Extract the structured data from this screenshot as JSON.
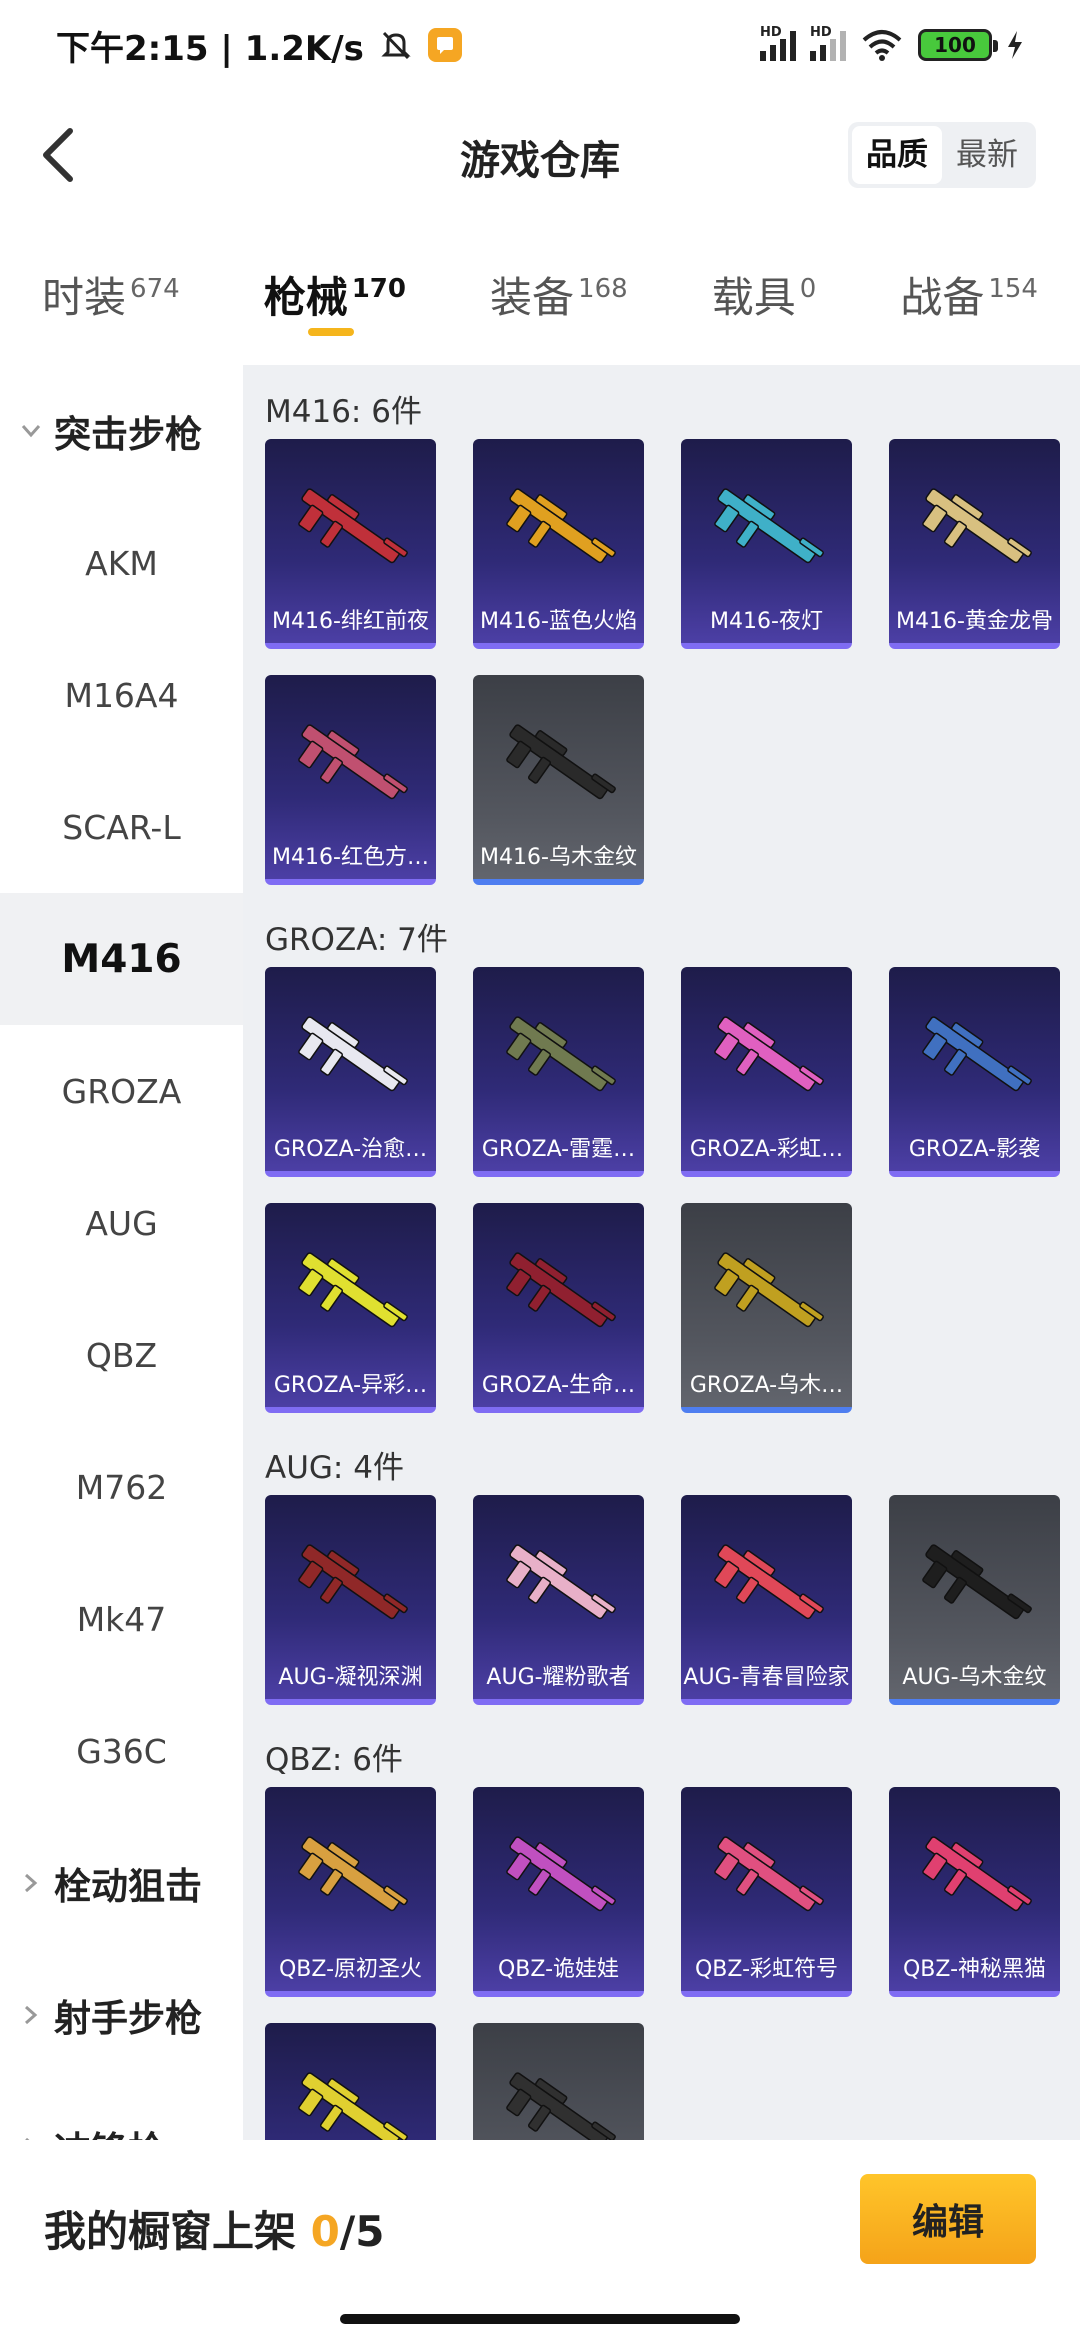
{
  "status_bar": {
    "time": "下午2:15 | 1.2K/s",
    "hd1": "HD",
    "hd2": "HD",
    "battery": "100"
  },
  "header": {
    "title": "游戏仓库",
    "sort_options": [
      "品质",
      "最新"
    ]
  },
  "tabs": [
    {
      "label": "时装",
      "count": "674"
    },
    {
      "label": "枪械",
      "count": "170"
    },
    {
      "label": "装备",
      "count": "168"
    },
    {
      "label": "载具",
      "count": "0"
    },
    {
      "label": "战备",
      "count": "154"
    }
  ],
  "sidebar": {
    "group_open": "突击步枪",
    "items": [
      "AKM",
      "M16A4",
      "SCAR-L",
      "M416",
      "GROZA",
      "AUG",
      "QBZ",
      "M762",
      "Mk47",
      "G36C"
    ],
    "group_closed_1": "栓动狙击",
    "group_closed_2": "射手步枪",
    "group_closed_3": "冲锋枪"
  },
  "sections": [
    {
      "title": "M416: 6件",
      "items": [
        {
          "label": "M416-绯红前夜",
          "gray": false,
          "color": "#c0303a"
        },
        {
          "label": "M416-蓝色火焰",
          "gray": false,
          "color": "#e0a020"
        },
        {
          "label": "M416-夜灯",
          "gray": false,
          "color": "#3fb0c8"
        },
        {
          "label": "M416-黄金龙骨",
          "gray": false,
          "color": "#d8c080"
        },
        {
          "label": "M416-红色方…",
          "gray": false,
          "color": "#c05070"
        },
        {
          "label": "M416-乌木金纹",
          "gray": true,
          "color": "#2a2a2a"
        }
      ]
    },
    {
      "title": "GROZA: 7件",
      "items": [
        {
          "label": "GROZA-治愈…",
          "gray": false,
          "color": "#e8e8f0"
        },
        {
          "label": "GROZA-雷霆…",
          "gray": false,
          "color": "#707a50"
        },
        {
          "label": "GROZA-彩虹…",
          "gray": false,
          "color": "#e060c0"
        },
        {
          "label": "GROZA-影袭",
          "gray": false,
          "color": "#4070c0"
        },
        {
          "label": "GROZA-异彩…",
          "gray": false,
          "color": "#e0e030"
        },
        {
          "label": "GROZA-生命…",
          "gray": false,
          "color": "#902030"
        },
        {
          "label": "GROZA-乌木…",
          "gray": true,
          "color": "#c0a020"
        }
      ]
    },
    {
      "title": "AUG: 4件",
      "items": [
        {
          "label": "AUG-凝视深渊",
          "gray": false,
          "color": "#902828"
        },
        {
          "label": "AUG-耀粉歌者",
          "gray": false,
          "color": "#e8b0c8"
        },
        {
          "label": "AUG-青春冒险家",
          "gray": false,
          "color": "#e04858"
        },
        {
          "label": "AUG-乌木金纹",
          "gray": true,
          "color": "#1e1e1e"
        }
      ]
    },
    {
      "title": "QBZ: 6件",
      "items": [
        {
          "label": "QBZ-原初圣火",
          "gray": false,
          "color": "#d8a040"
        },
        {
          "label": "QBZ-诡娃娃",
          "gray": false,
          "color": "#c050c0"
        },
        {
          "label": "QBZ-彩虹符号",
          "gray": false,
          "color": "#e05080"
        },
        {
          "label": "QBZ-神秘黑猫",
          "gray": false,
          "color": "#e04070"
        },
        {
          "label": "",
          "gray": false,
          "color": "#e0d030"
        },
        {
          "label": "",
          "gray": true,
          "color": "#303030"
        }
      ]
    }
  ],
  "bottom": {
    "shelf_label": "我的橱窗上架",
    "shelf_current": "0",
    "shelf_total": "/5",
    "edit_label": "编辑"
  }
}
